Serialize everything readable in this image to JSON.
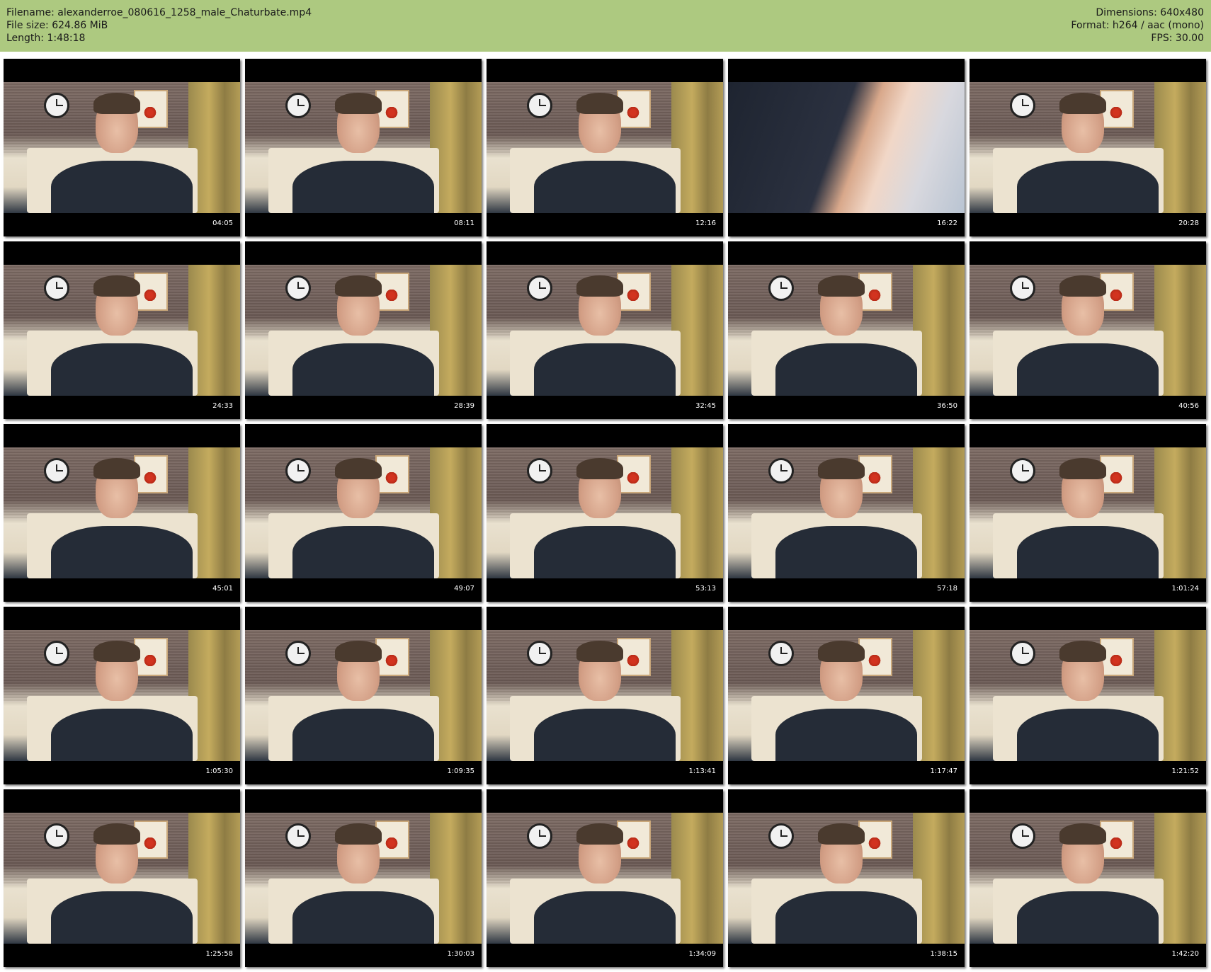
{
  "header": {
    "filename": "Filename: alexanderroe_080616_1258_male_Chaturbate.mp4",
    "file_size": "File size: 624.86 MiB",
    "length": "Length: 1:48:18",
    "dimensions": "Dimensions: 640x480",
    "format": "Format: h264 / aac (mono)",
    "fps": "FPS: 30.00"
  },
  "colors": {
    "header_bg": "#adc980",
    "thumbnail_bg": "#000000",
    "timestamp_text": "#ffffff"
  },
  "thumbnails": [
    {
      "time": "04:05"
    },
    {
      "time": "08:11"
    },
    {
      "time": "12:16"
    },
    {
      "time": "16:22"
    },
    {
      "time": "20:28"
    },
    {
      "time": "24:33"
    },
    {
      "time": "28:39"
    },
    {
      "time": "32:45"
    },
    {
      "time": "36:50"
    },
    {
      "time": "40:56"
    },
    {
      "time": "45:01"
    },
    {
      "time": "49:07"
    },
    {
      "time": "53:13"
    },
    {
      "time": "57:18"
    },
    {
      "time": "1:01:24"
    },
    {
      "time": "1:05:30"
    },
    {
      "time": "1:09:35"
    },
    {
      "time": "1:13:41"
    },
    {
      "time": "1:17:47"
    },
    {
      "time": "1:21:52"
    },
    {
      "time": "1:25:58"
    },
    {
      "time": "1:30:03"
    },
    {
      "time": "1:34:09"
    },
    {
      "time": "1:38:15"
    },
    {
      "time": "1:42:20"
    }
  ]
}
